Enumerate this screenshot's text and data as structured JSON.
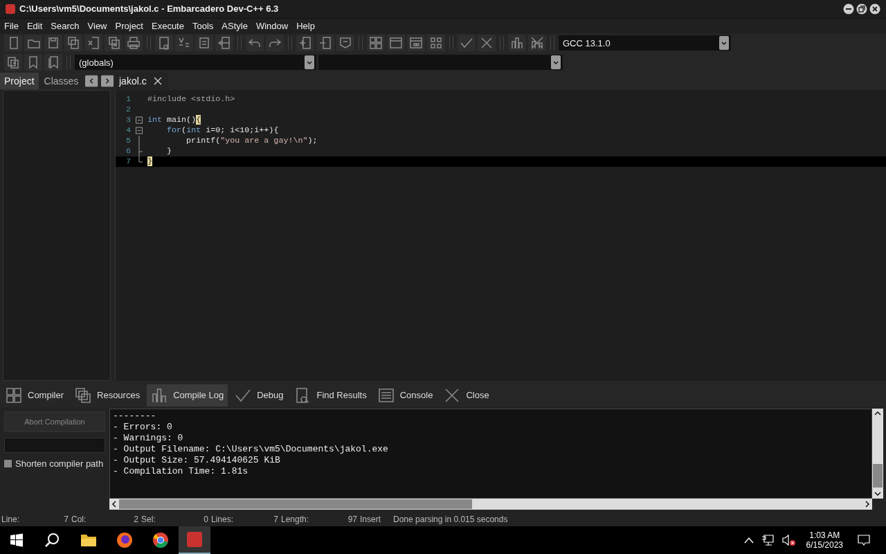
{
  "window": {
    "title": "C:\\Users\\vm5\\Documents\\jakol.c - Embarcadero Dev-C++ 6.3"
  },
  "menu": [
    "File",
    "Edit",
    "Search",
    "View",
    "Project",
    "Execute",
    "Tools",
    "AStyle",
    "Window",
    "Help"
  ],
  "compiler_select": {
    "value": "GCC 13.1.0"
  },
  "scope_select": {
    "value": "(globals)"
  },
  "side_tabs": [
    {
      "label": "Project",
      "selected": true
    },
    {
      "label": "Classes",
      "selected": false
    }
  ],
  "file_tabs": [
    {
      "label": "jakol.c",
      "selected": true
    }
  ],
  "editor": {
    "lines": [
      {
        "number": "1",
        "kind": "plain",
        "current": false,
        "tokens": [
          {
            "kind": "preproc",
            "text": "#include <stdio.h>"
          }
        ]
      },
      {
        "number": "2",
        "kind": "plain",
        "current": false
      },
      {
        "number": "3",
        "kind": "fold-start",
        "current": false,
        "tokens": [
          {
            "kind": "keyword",
            "text": "int"
          },
          {
            "kind": "plain",
            "text": " main()"
          },
          {
            "kind": "brace",
            "text": "{"
          }
        ]
      },
      {
        "number": "4",
        "kind": "fold-start",
        "current": false,
        "tokens": [
          {
            "kind": "keyword",
            "text": "    for"
          },
          {
            "kind": "plain",
            "text": "("
          },
          {
            "kind": "keyword",
            "text": "int"
          },
          {
            "kind": "plain",
            "text": " i=0; i<10;i++){"
          }
        ]
      },
      {
        "number": "5",
        "kind": "fold-line",
        "current": false,
        "tokens": [
          {
            "kind": "plain",
            "text": "        printf("
          },
          {
            "kind": "string",
            "text": "\"you are a gay!\\n\""
          },
          {
            "kind": "plain",
            "text": ");"
          }
        ]
      },
      {
        "number": "6",
        "kind": "fold-branch",
        "current": false,
        "tokens": [
          {
            "kind": "plain",
            "text": "    }"
          }
        ]
      },
      {
        "number": "7",
        "kind": "fold-end",
        "current": true,
        "tokens": [
          {
            "kind": "brace",
            "text": "}"
          }
        ]
      }
    ]
  },
  "bottom_tabs": [
    {
      "label": "Compiler",
      "selected": false
    },
    {
      "label": "Resources",
      "selected": false
    },
    {
      "label": "Compile Log",
      "selected": true
    },
    {
      "label": "Debug",
      "selected": false
    },
    {
      "label": "Find Results",
      "selected": false
    },
    {
      "label": "Console",
      "selected": false
    },
    {
      "label": "Close",
      "selected": false
    }
  ],
  "compile_panel": {
    "progress": {
      "level": 0
    },
    "abort_button": {
      "label": "Abort Compilation",
      "disabled": true
    },
    "shorten_path": {
      "label": "Shorten compiler path",
      "checked": false
    }
  },
  "log": [
    "--------",
    "- Errors: 0",
    "- Warnings: 0",
    "- Output Filename: C:\\Users\\vm5\\Documents\\jakol.exe",
    "- Output Size: 57.494140625 KiB",
    "- Compilation Time: 1.81s"
  ],
  "status_bar": [
    {
      "label": "Line:",
      "value": "7"
    },
    {
      "label": "Col:",
      "value": "2"
    },
    {
      "label": "Sel:",
      "value": "0"
    },
    {
      "label": "Lines:",
      "value": "7"
    },
    {
      "label": "Length:",
      "value": "97"
    },
    {
      "label": "Insert"
    }
  ],
  "status_message": "Done parsing in 0.015 seconds",
  "taskbar": {
    "time": "1:03 AM",
    "date": "6/15/2023"
  }
}
